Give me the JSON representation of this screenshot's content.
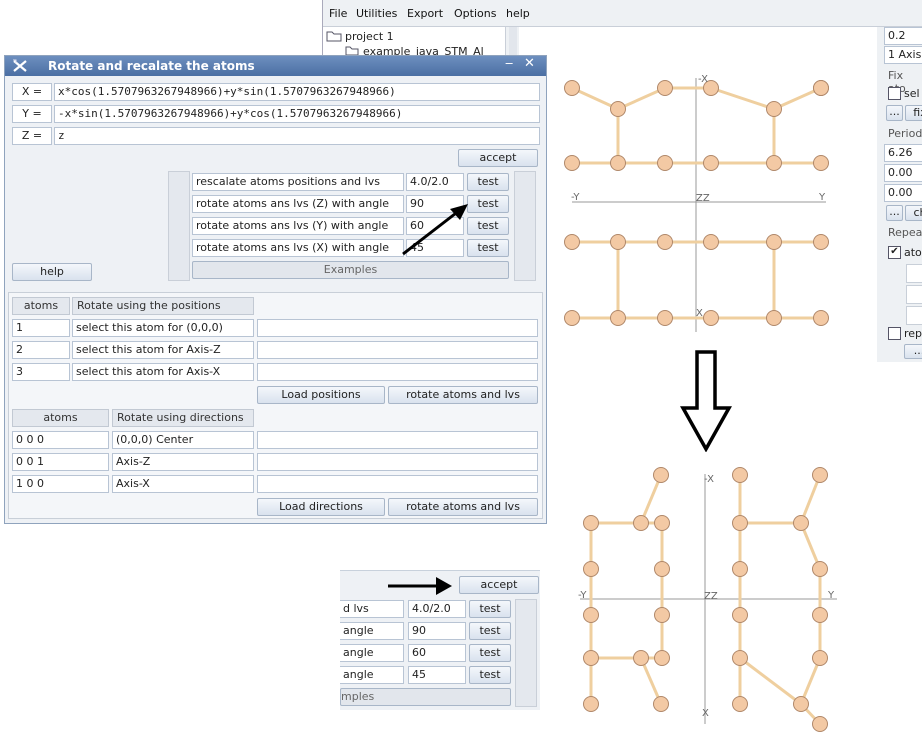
{
  "main_window": {
    "menu": [
      "File",
      "Utilities",
      "Export",
      "Options",
      "help"
    ],
    "tree": {
      "project": "project 1",
      "child": "example_java_STM_Al"
    },
    "side": {
      "value_top": "0.2",
      "axis_select": "1 Axis",
      "fix_label": "Fix ato",
      "sel_label": "sel",
      "fix_button": "fix",
      "period_label": "Period",
      "period_values": [
        "6.26",
        "0.00",
        "0.00"
      ],
      "ch_button": "ch",
      "repeat_label": "Repeat",
      "ato_label": "ato",
      "rep_label": "rep",
      "dots": "..."
    }
  },
  "dialog": {
    "title": "Rotate and recalate the atoms",
    "formulas": [
      {
        "label": "X =",
        "value": "x*cos(1.5707963267948966)+y*sin(1.5707963267948966)"
      },
      {
        "label": "Y =",
        "value": "-x*sin(1.5707963267948966)+y*cos(1.5707963267948966)"
      },
      {
        "label": "Z =",
        "value": "z"
      }
    ],
    "accept": "accept",
    "help": "help",
    "ops": [
      {
        "label": "rescalate atoms positions and lvs",
        "value": "4.0/2.0",
        "test": "test"
      },
      {
        "label": "rotate atoms ans lvs (Z) with angle",
        "value": "90",
        "test": "test"
      },
      {
        "label": "rotate atoms ans lvs (Y) with angle",
        "value": "60",
        "test": "test"
      },
      {
        "label": "rotate atoms ans lvs (X) with angle",
        "value": "45",
        "test": "test"
      }
    ],
    "examples": "Examples",
    "positions": {
      "header_atoms": "atoms",
      "header_desc": "Rotate using the positions",
      "rows": [
        {
          "atom": "1",
          "desc": "select this atom for (0,0,0)",
          "extra": ""
        },
        {
          "atom": "2",
          "desc": "select this atom for Axis-Z",
          "extra": ""
        },
        {
          "atom": "3",
          "desc": "select this atom for Axis-X",
          "extra": ""
        }
      ],
      "load": "Load positions",
      "rotate": "rotate atoms and lvs"
    },
    "directions": {
      "header_atoms": "atoms",
      "header_desc": "Rotate using directions",
      "rows": [
        {
          "atom": "0 0 0",
          "desc": "(0,0,0) Center",
          "extra": ""
        },
        {
          "atom": "0 0 1",
          "desc": "Axis-Z",
          "extra": ""
        },
        {
          "atom": "1 0 0",
          "desc": "Axis-X",
          "extra": ""
        }
      ],
      "load": "Load directions",
      "rotate": "rotate atoms and lvs"
    }
  },
  "zoom": {
    "accept": "accept",
    "ops": [
      {
        "label": "d lvs",
        "value": "4.0/2.0",
        "test": "test"
      },
      {
        "label": "angle",
        "value": "90",
        "test": "test"
      },
      {
        "label": "angle",
        "value": "60",
        "test": "test"
      },
      {
        "label": "angle",
        "value": "45",
        "test": "test"
      }
    ],
    "examples": "mples"
  },
  "structure_top": {
    "axis_labels": {
      "top": "-X",
      "left": "-Y",
      "right": "Y",
      "center": "ZZ",
      "bottom": "X"
    }
  },
  "structure_bottom": {
    "axis_labels": {
      "top": "-X",
      "left": "-Y",
      "right": "Y",
      "center": "ZZ",
      "bottom": "X"
    }
  },
  "colors": {
    "atom_fill": "#f3c9a4",
    "atom_stroke": "#b0886a",
    "bond": "#efcf9f",
    "axis": "#999999",
    "titlebar": "#5578ab"
  }
}
